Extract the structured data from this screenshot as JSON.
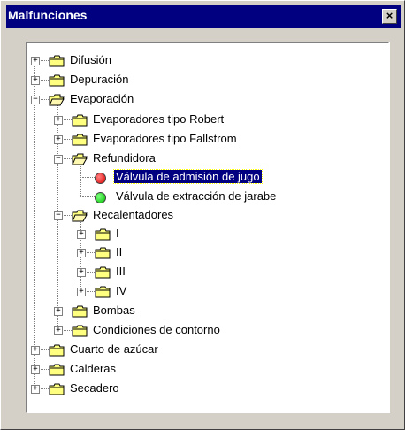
{
  "window": {
    "title": "Malfunciones",
    "close_label": "×"
  },
  "colors": {
    "title_bar": "#000080",
    "selection": "#000080",
    "fault_red": "#e00000",
    "fault_green": "#00c000",
    "folder": "#ffff80"
  },
  "tree": {
    "difusion": "Difusión",
    "depuracion": "Depuración",
    "evaporacion": "Evaporación",
    "evap_robert": "Evaporadores tipo Robert",
    "evap_fallstrom": "Evaporadores tipo Fallstrom",
    "refundidora": "Refundidora",
    "valvula_admision": "Válvula de admisión de jugo",
    "valvula_extraccion": "Válvula de extracción de jarabe",
    "recalentadores": "Recalentadores",
    "rec_i": "I",
    "rec_ii": "II",
    "rec_iii": "III",
    "rec_iv": "IV",
    "bombas": "Bombas",
    "condiciones": "Condiciones de contorno",
    "cuarto_azucar": "Cuarto de azúcar",
    "calderas": "Calderas",
    "secadero": "Secadero"
  },
  "expand_glyphs": {
    "collapsed": "+",
    "expanded": "−"
  }
}
